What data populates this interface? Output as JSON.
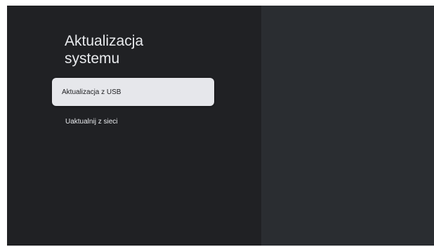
{
  "settings_panel": {
    "title": "Aktualizacja\nsystemu",
    "items": [
      {
        "label": "Aktualizacja z USB",
        "selected": true
      },
      {
        "label": "Uaktualnij z sieci",
        "selected": false
      }
    ]
  },
  "colors": {
    "background": "#202124",
    "right_pane": "#2a2d31",
    "selected_item": "#e6e7eb",
    "text_primary": "#e8eaed",
    "text_selected": "#202124"
  }
}
